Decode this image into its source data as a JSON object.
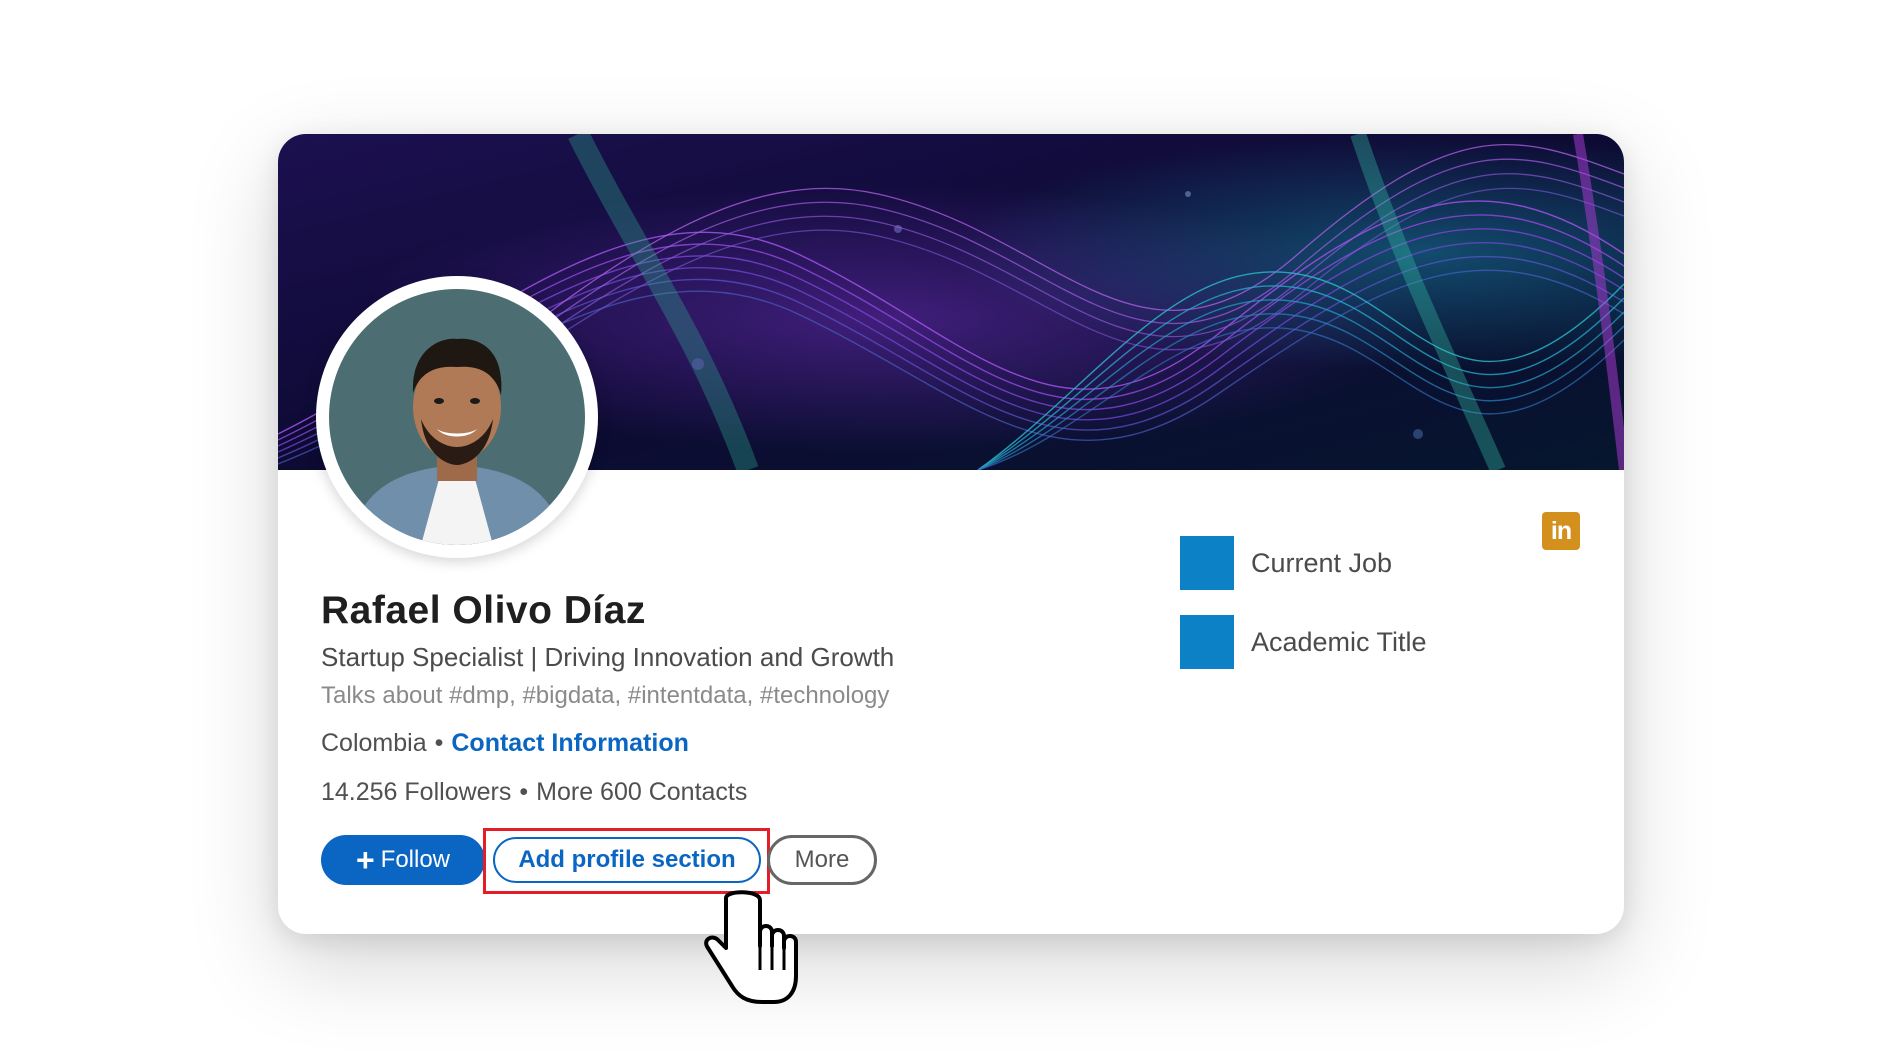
{
  "profile": {
    "name": "Rafael Olivo Díaz",
    "headline": "Startup Specialist | Driving Innovation and Growth",
    "talks_about": "Talks about #dmp, #bigdata, #intentdata, #technology",
    "location": "Colombia",
    "separator": "•",
    "contact_link": "Contact Information",
    "followers": "14.256 Followers",
    "contacts": "More 600 Contacts"
  },
  "actions": {
    "follow_icon": "+",
    "follow_label": "Follow",
    "add_section_label": "Add profile section",
    "more_label": "More"
  },
  "sidebar": {
    "items": [
      {
        "label": "Current Job",
        "icon": "blue-square-icon"
      },
      {
        "label": "Academic Title",
        "icon": "blue-square-icon"
      }
    ]
  },
  "badge": {
    "text": "in",
    "icon": "linkedin-icon"
  },
  "colors": {
    "accent": "#0a66c2",
    "highlight": "#e41e26",
    "side_square": "#0c81c6",
    "linkedin_badge": "#d4901d",
    "banner_bg": "#120a3a"
  }
}
